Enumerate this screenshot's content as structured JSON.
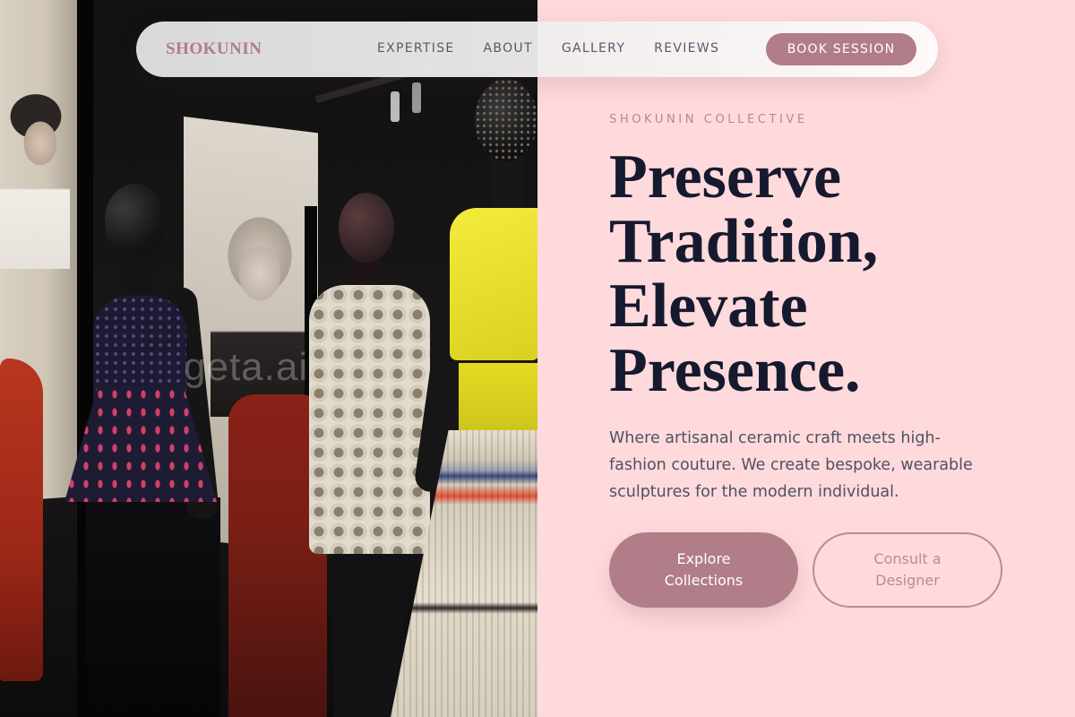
{
  "nav": {
    "brand": "SHOKUNIN",
    "links": [
      "EXPERTISE",
      "ABOUT",
      "GALLERY",
      "REVIEWS"
    ],
    "cta_label": "BOOK SESSION"
  },
  "hero": {
    "eyebrow": "SHOKUNIN COLLECTIVE",
    "headline_lines": [
      "Preserve",
      "Tradition,",
      "Elevate",
      "Presence."
    ],
    "description": "Where artisanal ceramic craft meets high-fashion couture. We create bespoke, wearable sculptures for the modern individual.",
    "primary_button": "Explore Collections",
    "secondary_button": "Consult a Designer"
  },
  "image": {
    "watermark": "geta.ai"
  },
  "colors": {
    "accent": "#b07d88",
    "background": "#ffdadc",
    "headline": "#161a2e",
    "body_text": "#4e5262"
  }
}
